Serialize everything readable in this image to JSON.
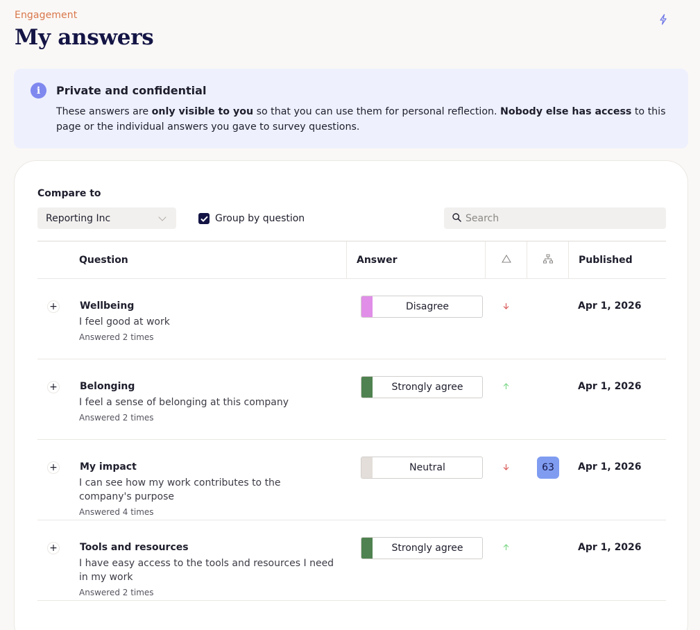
{
  "header": {
    "eyebrow": "Engagement",
    "title": "My answers",
    "icon": "lightning-icon"
  },
  "notice": {
    "title": "Private and confidential",
    "body_1": "These answers are ",
    "body_bold_1": "only visible to you",
    "body_2": " so that you can use them for personal reflection. ",
    "body_bold_2": "Nobody else has access",
    "body_3": " to this page or the individual answers you gave to survey questions."
  },
  "filters": {
    "compare_label": "Compare to",
    "compare_value": "Reporting Inc",
    "group_by_label": "Group by question",
    "group_by_checked": true,
    "search_placeholder": "Search"
  },
  "table": {
    "columns": {
      "question": "Question",
      "answer": "Answer",
      "trend_icon": "triangle-icon",
      "benchmark_icon": "org-chart-icon",
      "published": "Published"
    },
    "rows": [
      {
        "category": "Wellbeing",
        "question": "I feel good at work",
        "answered": "Answered 2 times",
        "answer": "Disagree",
        "answer_color": "#e08ee8",
        "trend": "down",
        "benchmark": "",
        "published": "Apr 1, 2026"
      },
      {
        "category": "Belonging",
        "question": "I feel a sense of belonging at this company",
        "answered": "Answered 2 times",
        "answer": "Strongly agree",
        "answer_color": "#4f8250",
        "trend": "up",
        "benchmark": "",
        "published": "Apr 1, 2026"
      },
      {
        "category": "My impact",
        "question": "I can see how my work contributes to the company's purpose",
        "answered": "Answered 4 times",
        "answer": "Neutral",
        "answer_color": "#e3ded9",
        "trend": "down",
        "benchmark": "63",
        "published": "Apr 1, 2026"
      },
      {
        "category": "Tools and resources",
        "question": "I have easy access to the tools and resources I need in my work",
        "answered": "Answered 2 times",
        "answer": "Strongly agree",
        "answer_color": "#4f8250",
        "trend": "up",
        "benchmark": "",
        "published": "Apr 1, 2026"
      }
    ]
  },
  "colors": {
    "accent": "#141545",
    "eyebrow": "#d9764a",
    "trend_up": "#7ed88a",
    "trend_down": "#d95a5a",
    "benchmark": "#7f9cf1"
  }
}
